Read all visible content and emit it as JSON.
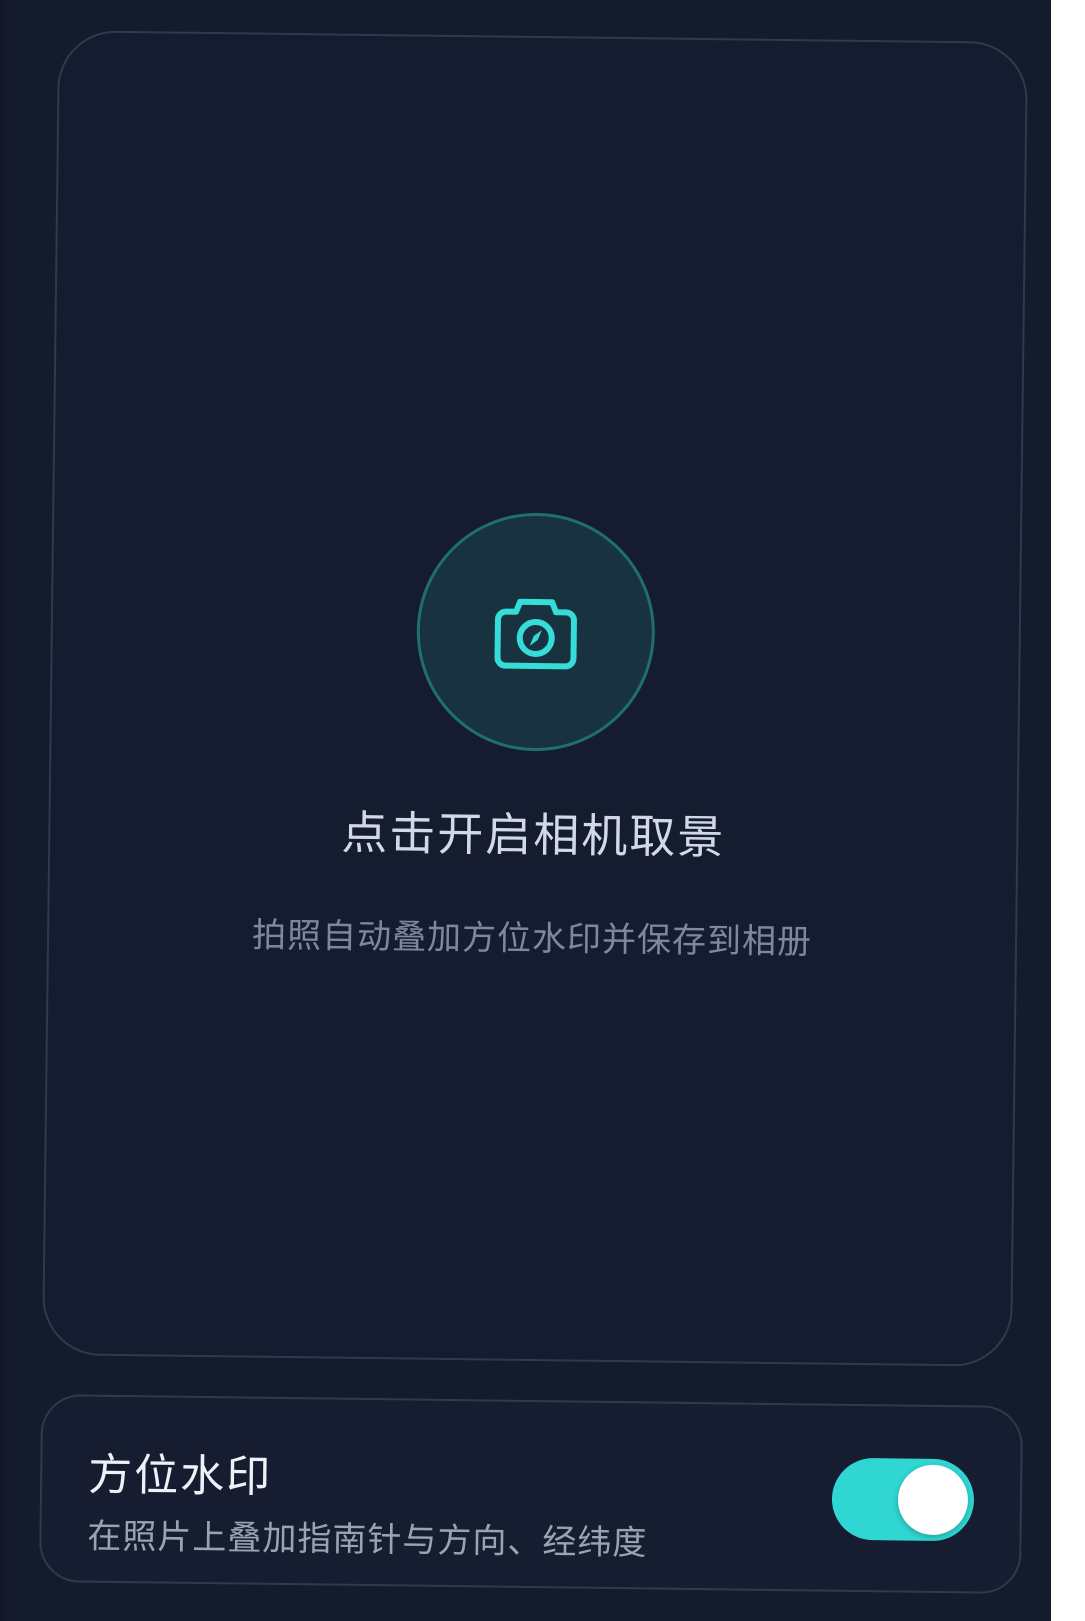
{
  "viewfinder": {
    "cta_title": "点击开启相机取景",
    "cta_subtitle": "拍照自动叠加方位水印并保存到相册",
    "icon": "camera-icon"
  },
  "watermark_setting": {
    "title": "方位水印",
    "description": "在照片上叠加指南针与方向、经纬度",
    "enabled": true
  },
  "colors": {
    "background": "#141b2c",
    "accent": "#2fd6d2",
    "card_border": "#2e3a4e"
  }
}
